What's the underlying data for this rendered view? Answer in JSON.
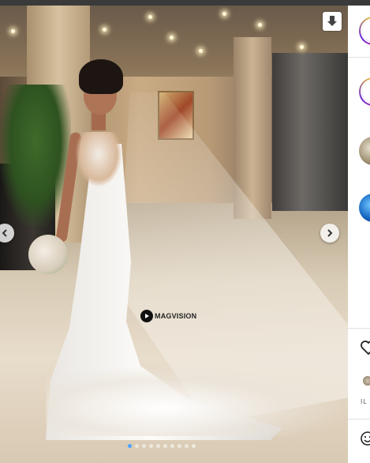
{
  "post": {
    "watermark_text": "MAGVISION",
    "watermark_sub": "",
    "carousel": {
      "count": 10,
      "active_index": 0
    }
  },
  "controls": {
    "download_icon": "download-icon",
    "prev_icon": "chevron-left-icon",
    "next_icon": "chevron-right-icon"
  },
  "side_panel": {
    "truncated_text": "IL",
    "icons": [
      "heart-icon",
      "emoji-icon"
    ]
  },
  "colors": {
    "carousel_active": "#4aa3ff",
    "story_ring": "#ee2a7b"
  }
}
